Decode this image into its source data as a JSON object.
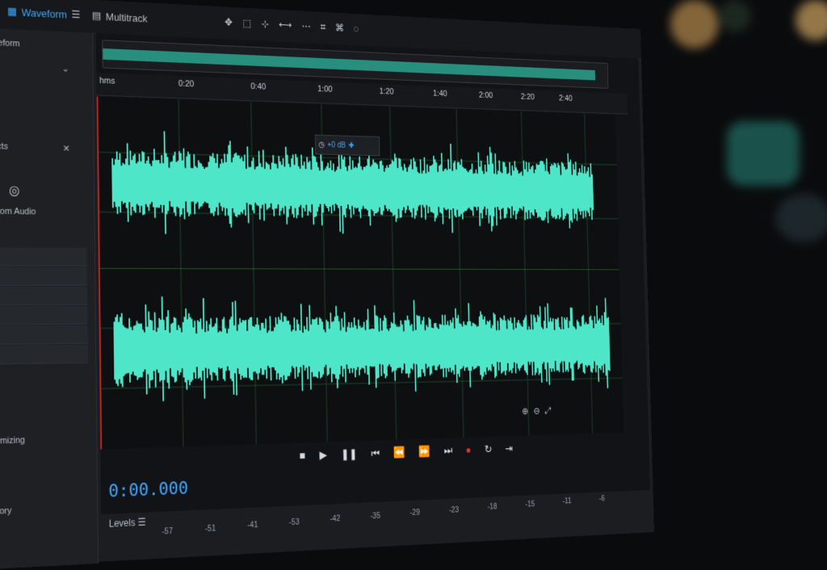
{
  "tabs": [
    {
      "label": "Waveform",
      "active": true
    },
    {
      "label": "Multitrack",
      "active": false
    }
  ],
  "toolbar_icons": [
    "move-icon",
    "marquee-icon",
    "scrub-icon",
    "time-select-icon",
    "spectral-icon",
    "heal-icon",
    "lasso-icon",
    "brush-icon"
  ],
  "sidebar": {
    "panel_title": "Waveform",
    "effects_title": "Effects",
    "preset": "Custom Audio",
    "section2": "Optimizing",
    "section3": "History"
  },
  "ruler": {
    "unit": "hms",
    "ticks": [
      "0:20",
      "0:40",
      "1:00",
      "1:20",
      "1:40",
      "2:00",
      "2:20",
      "2:40"
    ]
  },
  "hud": {
    "gain": "+0 dB"
  },
  "transport": {
    "buttons": [
      "stop",
      "play",
      "pause",
      "to-start",
      "rewind",
      "fast-forward",
      "to-end",
      "record",
      "loop",
      "skip"
    ]
  },
  "time_display": "0:00.000",
  "levels": {
    "label": "Levels",
    "scale": [
      "-57",
      "-51",
      "-41",
      "-53",
      "-42",
      "-35",
      "-29",
      "-23",
      "-18",
      "-15",
      "-11",
      "-6"
    ]
  },
  "colors": {
    "waveform": "#4ee6c8",
    "accent": "#3ea8ff",
    "playhead": "#c02424",
    "record": "#e03030"
  }
}
